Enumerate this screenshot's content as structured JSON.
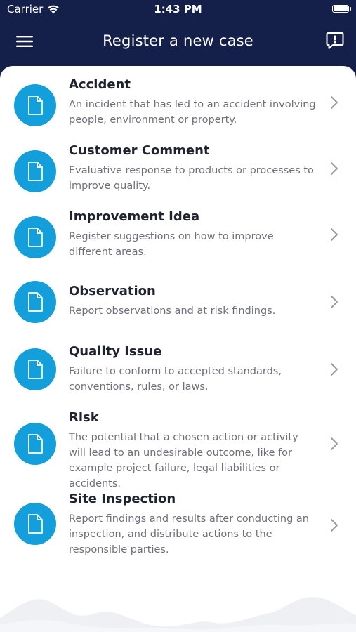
{
  "status_bar": {
    "carrier": "Carrier",
    "time": "1:43 PM"
  },
  "header": {
    "title": "Register a new case"
  },
  "case_types": [
    {
      "title": "Accident",
      "description": "An incident that has led to an accident involving people, environment or property."
    },
    {
      "title": "Customer Comment",
      "description": "Evaluative response to products or processes to improve quality."
    },
    {
      "title": "Improvement Idea",
      "description": "Register suggestions on how to improve different areas."
    },
    {
      "title": "Observation",
      "description": "Report observations and at risk findings."
    },
    {
      "title": "Quality Issue",
      "description": "Failure to conform to accepted standards, conventions, rules, or laws."
    },
    {
      "title": "Risk",
      "description": "The potential that a chosen action or activity will lead to an undesirable outcome, like for example project failure, legal liabilities or accidents."
    },
    {
      "title": "Site Inspection",
      "description": "Report findings and results after conducting an inspection, and distribute actions to the responsible parties."
    }
  ],
  "icons": {
    "case_type": "document-icon",
    "row_action": "chevron-right-icon",
    "menu": "hamburger-menu-icon",
    "feedback": "feedback-icon"
  },
  "colors": {
    "header_bg": "#14204a",
    "accent": "#139fdb",
    "title_text": "#1f2330",
    "description_text": "#6d7079"
  }
}
